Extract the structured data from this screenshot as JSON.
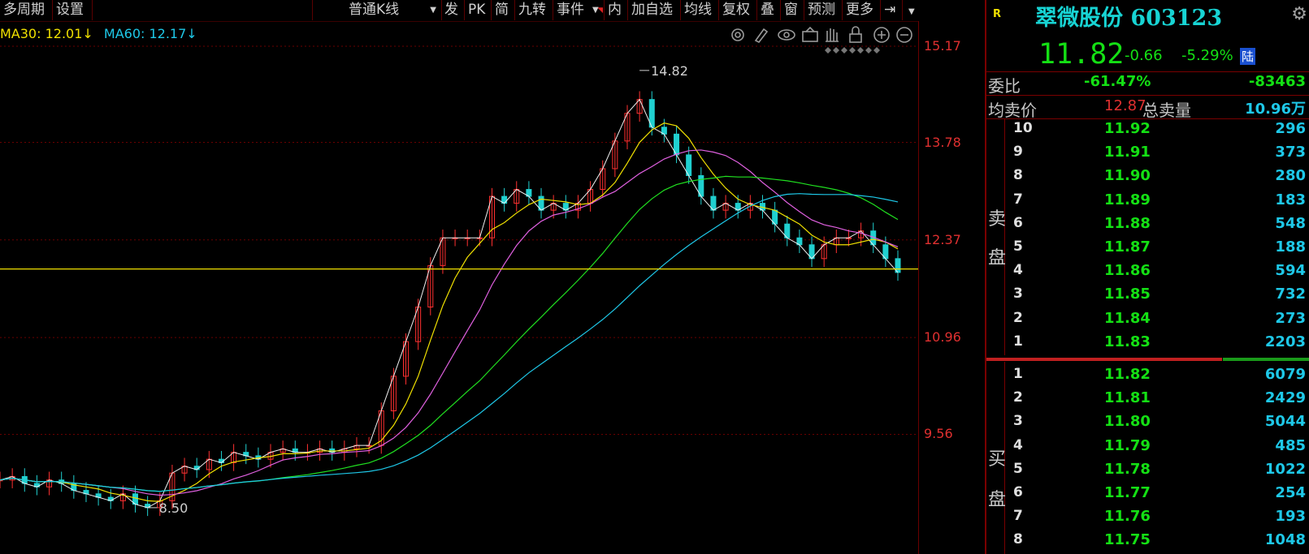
{
  "toolbar": {
    "items": [
      "多周期",
      "设置",
      "普通K线",
      "发",
      "PK",
      "简",
      "九转",
      "事件",
      "内",
      "加自选",
      "均线",
      "复权",
      "叠",
      "窗",
      "预测",
      "更多"
    ]
  },
  "ma_legend": {
    "ma30_label": "MA30: 12.01↓",
    "ma60_label": "MA60: 12.17↓",
    "ma30_color": "#f0e000",
    "ma60_color": "#1ec8e8"
  },
  "chart_tools": [
    "settings-icon",
    "pen-icon",
    "eye-icon",
    "basket-icon",
    "hand-icon",
    "lock-icon",
    "zoom-in-icon",
    "zoom-out-icon"
  ],
  "price_axis": {
    "labels": [
      "15.17",
      "13.78",
      "12.37",
      "10.96",
      "9.56"
    ],
    "min": 8.1,
    "max": 15.17
  },
  "chart_data": {
    "type": "candlestick",
    "high_marker": "14.82",
    "low_marker": "8.50",
    "ylim": [
      8.1,
      15.17
    ],
    "grid": true,
    "gridlines": [
      15.17,
      13.78,
      12.37,
      10.96,
      9.56
    ],
    "close_series": [
      8.9,
      8.95,
      8.85,
      8.8,
      8.9,
      8.85,
      8.75,
      8.7,
      8.65,
      8.6,
      8.7,
      8.55,
      8.5,
      8.6,
      9.0,
      9.1,
      9.05,
      9.2,
      9.15,
      9.3,
      9.25,
      9.2,
      9.3,
      9.35,
      9.3,
      9.3,
      9.35,
      9.3,
      9.35,
      9.4,
      9.4,
      9.9,
      10.4,
      10.9,
      11.4,
      12.0,
      12.4,
      12.4,
      12.4,
      12.4,
      13.0,
      12.9,
      13.1,
      13.0,
      12.8,
      12.9,
      12.8,
      12.9,
      13.1,
      13.4,
      13.8,
      14.2,
      14.4,
      14.0,
      13.9,
      13.6,
      13.3,
      13.0,
      12.8,
      12.9,
      12.8,
      12.9,
      12.8,
      12.6,
      12.4,
      12.3,
      12.1,
      12.3,
      12.4,
      12.4,
      12.5,
      12.3,
      12.1,
      11.9
    ],
    "ma_line": 11.95,
    "ma_line_color": "#f0e000"
  },
  "quote": {
    "name": "翠微股份 603123",
    "badge": "R",
    "price": "11.82",
    "change": "-0.66",
    "change_pct": "-5.29%",
    "market_tag": "陆",
    "weibi_label": "委比",
    "weibi_pct": "-61.47%",
    "weibi_val": "-83463",
    "avg_sell_label": "均卖价",
    "avg_sell_price": "12.87",
    "total_sell_label": "总卖量",
    "total_sell_vol": "10.96万",
    "sell_side_label_1": "卖",
    "sell_side_label_2": "盘",
    "buy_side_label_1": "买",
    "buy_side_label_2": "盘",
    "sell_levels": [
      {
        "level": "10",
        "price": "11.92",
        "vol": "296"
      },
      {
        "level": "9",
        "price": "11.91",
        "vol": "373"
      },
      {
        "level": "8",
        "price": "11.90",
        "vol": "280"
      },
      {
        "level": "7",
        "price": "11.89",
        "vol": "183"
      },
      {
        "level": "6",
        "price": "11.88",
        "vol": "548"
      },
      {
        "level": "5",
        "price": "11.87",
        "vol": "188"
      },
      {
        "level": "4",
        "price": "11.86",
        "vol": "594"
      },
      {
        "level": "3",
        "price": "11.85",
        "vol": "732"
      },
      {
        "level": "2",
        "price": "11.84",
        "vol": "273"
      },
      {
        "level": "1",
        "price": "11.83",
        "vol": "2203"
      }
    ],
    "buy_levels": [
      {
        "level": "1",
        "price": "11.82",
        "vol": "6079"
      },
      {
        "level": "2",
        "price": "11.81",
        "vol": "2429"
      },
      {
        "level": "3",
        "price": "11.80",
        "vol": "5044"
      },
      {
        "level": "4",
        "price": "11.79",
        "vol": "485"
      },
      {
        "level": "5",
        "price": "11.78",
        "vol": "1022"
      },
      {
        "level": "6",
        "price": "11.77",
        "vol": "254"
      },
      {
        "level": "7",
        "price": "11.76",
        "vol": "193"
      },
      {
        "level": "8",
        "price": "11.75",
        "vol": "1048"
      }
    ]
  }
}
